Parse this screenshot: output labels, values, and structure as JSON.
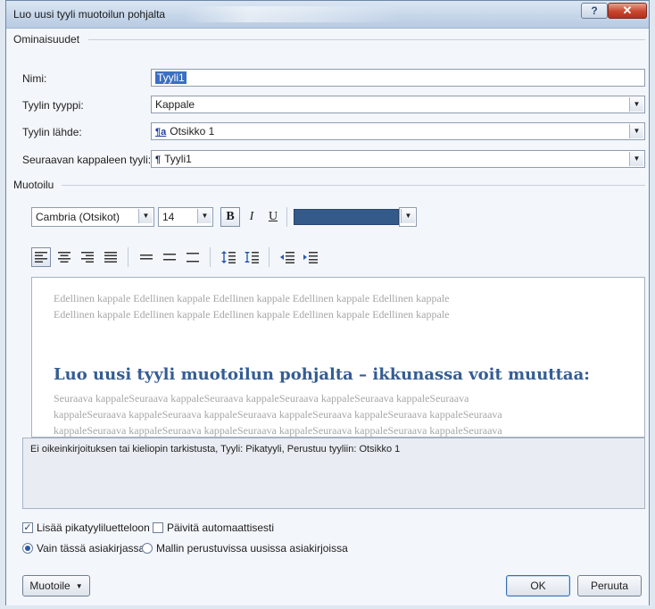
{
  "window": {
    "title": "Luo uusi tyyli muotoilun pohjalta"
  },
  "properties": {
    "section_label": "Ominaisuudet",
    "name_label": "Nimi:",
    "name_value": "Tyyli1",
    "type_label": "Tyylin tyyppi:",
    "type_value": "Kappale",
    "based_on_label": "Tyylin lähde:",
    "based_on_value": "Otsikko 1",
    "next_label": "Seuraavan kappaleen tyyli:",
    "next_value": "Tyyli1"
  },
  "formatting": {
    "section_label": "Muotoilu",
    "font": "Cambria (Otsikot)",
    "size": "14",
    "bold": "B",
    "italic": "I",
    "underline": "U",
    "color": "#345a8a"
  },
  "preview": {
    "previous_line1": "Edellinen kappale Edellinen kappale Edellinen kappale Edellinen kappale Edellinen kappale",
    "previous_line2": "Edellinen kappale Edellinen kappale Edellinen kappale Edellinen kappale Edellinen kappale",
    "heading": "Luo uusi tyyli muotoilun pohjalta – ikkunassa voit muuttaa:",
    "following_line1": "Seuraava kappaleSeuraava kappaleSeuraava kappaleSeuraava kappaleSeuraava kappaleSeuraava",
    "following_line2": "kappaleSeuraava kappaleSeuraava kappaleSeuraava kappaleSeuraava kappaleSeuraava kappaleSeuraava",
    "following_line3": "kappaleSeuraava kappaleSeuraava kappaleSeuraava kappaleSeuraava kappaleSeuraava kappaleSeuraava"
  },
  "description": "Ei oikeinkirjoituksen tai kieliopin tarkistusta, Tyyli: Pikatyyli, Perustuu tyyliin: Otsikko 1",
  "options": {
    "add_quick_styles": "Lisää pikatyyliluetteloon",
    "auto_update": "Päivitä automaattisesti",
    "only_this_document": "Vain tässä asiakirjassa",
    "new_documents": "Mallin perustuvissa uusissa asiakirjoissa"
  },
  "buttons": {
    "format": "Muotoile",
    "ok": "OK",
    "cancel": "Peruuta"
  }
}
